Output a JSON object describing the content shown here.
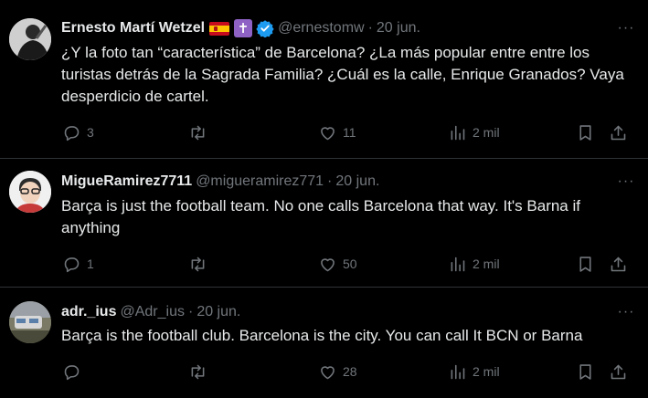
{
  "tweets": [
    {
      "name": "Ernesto Martí Wetzel",
      "handle": "@ernestomw",
      "sep": "·",
      "date": "20 jun.",
      "text": "¿Y la foto tan “característica” de Barcelona? ¿La más popular entre entre los turistas detrás de la Sagrada Familia? ¿Cuál es la calle, Enrique Granados? Vaya desperdicio de cartel.",
      "replies": "3",
      "retweets": "",
      "likes": "11",
      "views": "2 mil",
      "badges": [
        "spain-flag-icon",
        "latin-cross-icon",
        "verified-badge-icon"
      ],
      "badge_colors": {
        "cross": "#8e62c4",
        "verified": "#1d9bf0"
      }
    },
    {
      "name": "MigueRamirez7711",
      "handle": "@migueramirez771",
      "sep": "·",
      "date": "20 jun.",
      "text": "Barça is just the football team. No one calls Barcelona that way. It's Barna if anything",
      "replies": "1",
      "retweets": "",
      "likes": "50",
      "views": "2 mil"
    },
    {
      "name": "adr._ius",
      "handle": "@Adr_ius",
      "sep": "·",
      "date": "20 jun.",
      "text": "Barça is the football club. Barcelona is the city. You can call It BCN or Barna",
      "replies": "",
      "retweets": "",
      "likes": "28",
      "views": "2 mil"
    }
  ],
  "icons": [
    "reply-icon",
    "retweet-icon",
    "like-icon",
    "views-icon",
    "bookmark-icon",
    "share-icon",
    "more-icon"
  ],
  "colors": {
    "background": "#000000",
    "text": "#e7e9ea",
    "muted": "#71767b",
    "border": "#2f3336"
  }
}
